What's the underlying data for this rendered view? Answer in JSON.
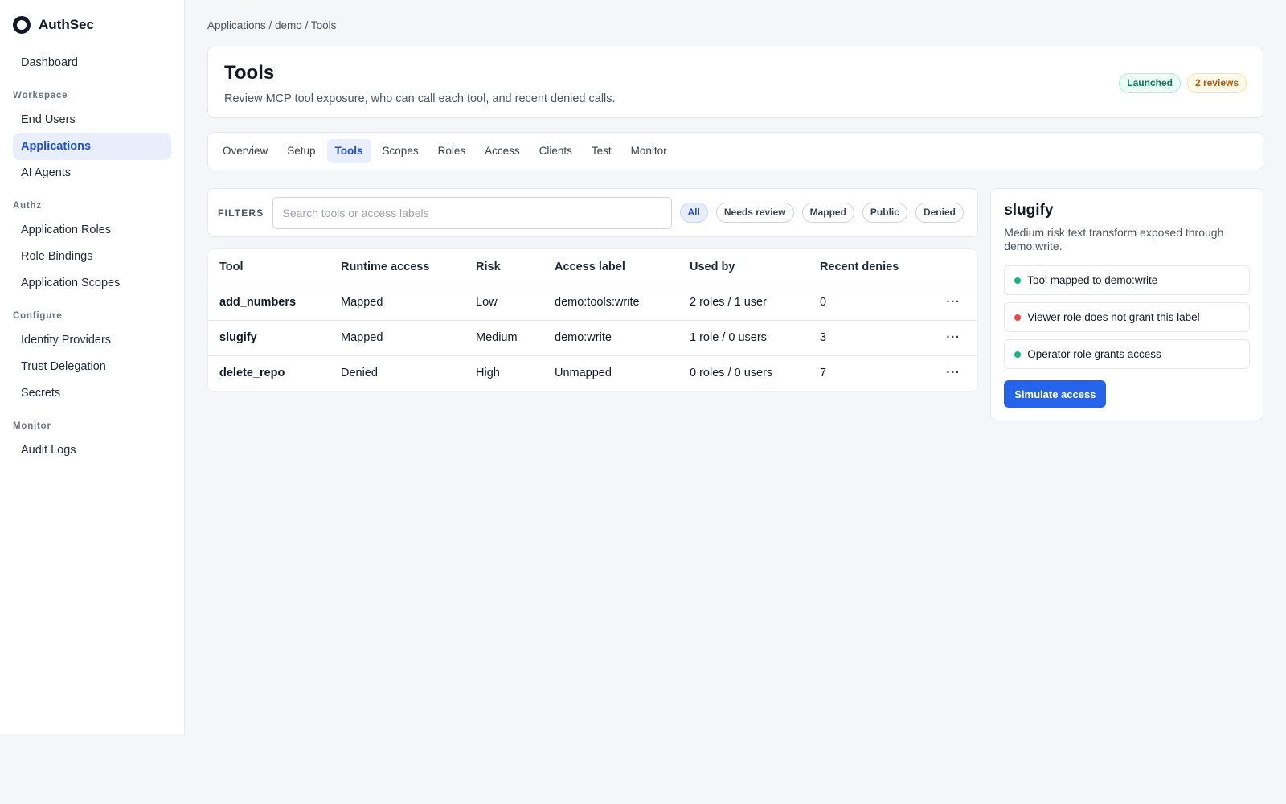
{
  "brand": {
    "name": "AuthSec"
  },
  "sidebar": {
    "top": [
      {
        "label": "Dashboard"
      }
    ],
    "sections": [
      {
        "title": "Workspace",
        "items": [
          {
            "label": "End Users"
          },
          {
            "label": "Applications"
          },
          {
            "label": "AI Agents"
          }
        ]
      },
      {
        "title": "Authz",
        "items": [
          {
            "label": "Application Roles"
          },
          {
            "label": "Role Bindings"
          },
          {
            "label": "Application Scopes"
          }
        ]
      },
      {
        "title": "Configure",
        "items": [
          {
            "label": "Identity Providers"
          },
          {
            "label": "Trust Delegation"
          },
          {
            "label": "Secrets"
          }
        ]
      },
      {
        "title": "Monitor",
        "items": [
          {
            "label": "Audit Logs"
          }
        ]
      }
    ],
    "active": "Applications"
  },
  "breadcrumb": "Applications / demo / Tools",
  "header": {
    "title": "Tools",
    "subtitle": "Review MCP tool exposure, who can call each tool, and recent denied calls.",
    "badges": {
      "launched": "Launched",
      "reviews": "2 reviews"
    }
  },
  "tabs": [
    "Overview",
    "Setup",
    "Tools",
    "Scopes",
    "Roles",
    "Access",
    "Clients",
    "Test",
    "Monitor"
  ],
  "active_tab": "Tools",
  "filters": {
    "label": "FILTERS",
    "search_placeholder": "Search tools or access labels",
    "chips": [
      "All",
      "Needs review",
      "Mapped",
      "Public",
      "Denied"
    ],
    "active_chip": "All"
  },
  "table": {
    "headers": [
      "Tool",
      "Runtime access",
      "Risk",
      "Access label",
      "Used by",
      "Recent denies"
    ],
    "rows": [
      [
        "add_numbers",
        "Mapped",
        "Low",
        "demo:tools:write",
        "2 roles / 1 user",
        "0"
      ],
      [
        "slugify",
        "Mapped",
        "Medium",
        "demo:write",
        "1 role / 0 users",
        "3"
      ],
      [
        "delete_repo",
        "Denied",
        "High",
        "Unmapped",
        "0 roles / 0 users",
        "7"
      ]
    ],
    "more_glyph": "···"
  },
  "panel": {
    "title": "slugify",
    "description": "Medium risk text transform exposed through demo:write.",
    "checks": [
      {
        "text": "Tool mapped to demo:write",
        "status": "ok",
        "color": "#10b981"
      },
      {
        "text": "Viewer role does not grant this label",
        "status": "fail",
        "color": "#ef4444"
      },
      {
        "text": "Operator role grants access",
        "status": "ok",
        "color": "#10b981"
      }
    ],
    "button": "Simulate access"
  },
  "colors": {
    "accent": "#2563eb",
    "ok": "#10b981",
    "fail": "#ef4444"
  }
}
